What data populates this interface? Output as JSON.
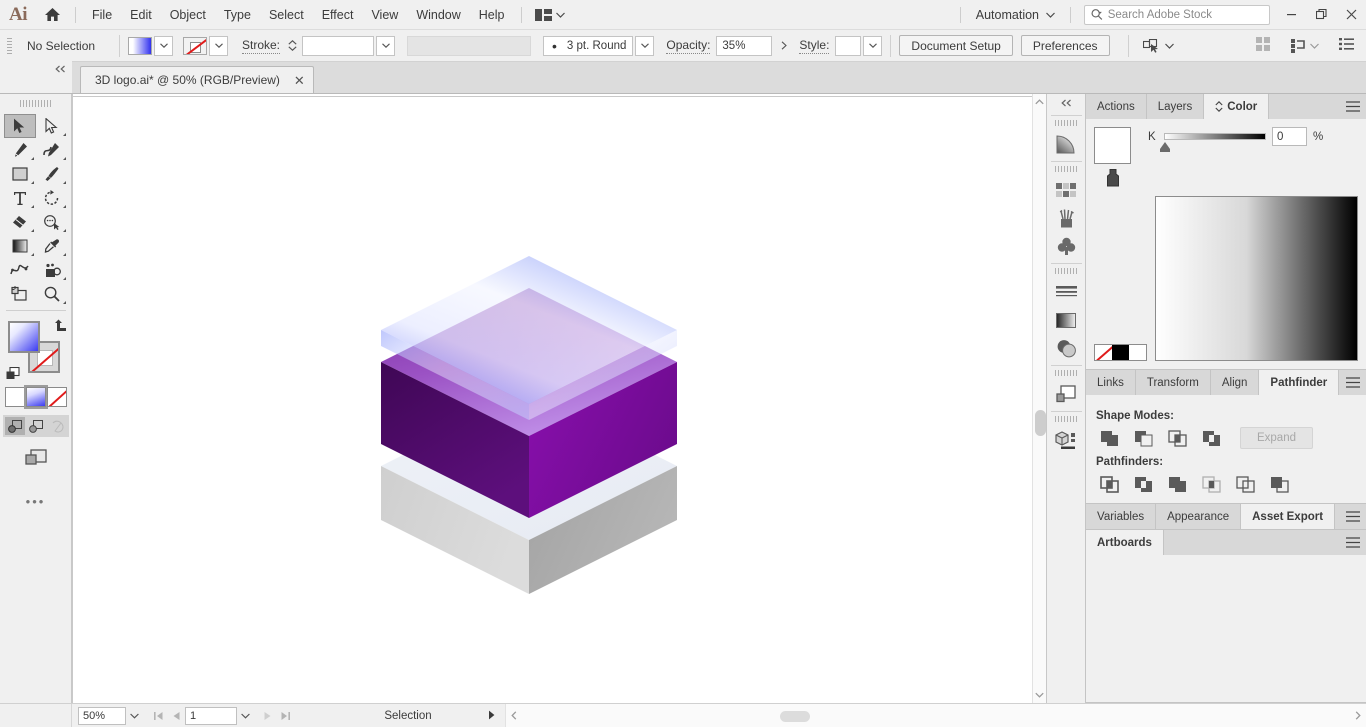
{
  "app": {
    "name": "Adobe Illustrator",
    "logo_text": "Ai"
  },
  "menubar": {
    "home_icon": "home-icon",
    "items": [
      {
        "label": "File"
      },
      {
        "label": "Edit"
      },
      {
        "label": "Object"
      },
      {
        "label": "Type"
      },
      {
        "label": "Select"
      },
      {
        "label": "Effect"
      },
      {
        "label": "View"
      },
      {
        "label": "Window"
      },
      {
        "label": "Help"
      }
    ],
    "arrange_icon": "arrange-documents-icon",
    "workspace": {
      "label": "Automation",
      "chevron": "chevron-down-icon"
    },
    "search": {
      "placeholder": "Search Adobe Stock",
      "value": "",
      "icon": "search-icon"
    },
    "window_controls": {
      "minimize": "minimize-icon",
      "restore": "restore-icon",
      "close": "close-icon"
    }
  },
  "controlbar": {
    "selection_state": "No Selection",
    "fill_swatch": "gradient-fill-swatch",
    "stroke_swatch": "none-stroke-swatch",
    "stroke_label": "Stroke:",
    "stroke_weight": "",
    "stroke_profile": "",
    "brush_label": "3 pt. Round",
    "opacity_label": "Opacity:",
    "opacity_value": "35%",
    "style_label": "Style:",
    "style_value": "",
    "document_setup_label": "Document Setup",
    "preferences_label": "Preferences",
    "select_similar_icon": "select-similar-objects-icon",
    "right_icons": [
      {
        "name": "grid-view-icon"
      },
      {
        "name": "align-options-icon"
      },
      {
        "name": "panel-list-icon"
      }
    ]
  },
  "document": {
    "tab_title": "3D logo.ai* @ 50% (RGB/Preview)",
    "close_icon": "close-icon",
    "collapse_icon": "collapse-panel-icon"
  },
  "toolbar": {
    "grip": "panel-grip",
    "tools": [
      {
        "name": "selection-tool",
        "active": true,
        "has_flyout": false
      },
      {
        "name": "direct-selection-tool",
        "active": false,
        "has_flyout": true
      },
      {
        "name": "pen-tool",
        "active": false,
        "has_flyout": true
      },
      {
        "name": "curvature-tool",
        "active": false,
        "has_flyout": true
      },
      {
        "name": "rectangle-tool",
        "active": false,
        "has_flyout": true
      },
      {
        "name": "paintbrush-tool",
        "active": false,
        "has_flyout": true
      },
      {
        "name": "type-tool",
        "active": false,
        "has_flyout": true
      },
      {
        "name": "rotate-tool",
        "active": false,
        "has_flyout": true
      },
      {
        "name": "eraser-tool",
        "active": false,
        "has_flyout": true
      },
      {
        "name": "shape-builder-tool",
        "active": false,
        "has_flyout": true
      },
      {
        "name": "gradient-tool",
        "active": false,
        "has_flyout": true
      },
      {
        "name": "eyedropper-tool",
        "active": false,
        "has_flyout": true
      },
      {
        "name": "blend-tool",
        "active": false,
        "has_flyout": false
      },
      {
        "name": "symbol-sprayer-tool",
        "active": false,
        "has_flyout": true
      },
      {
        "name": "artboard-tool",
        "active": false,
        "has_flyout": false
      },
      {
        "name": "zoom-tool",
        "active": false,
        "has_flyout": true
      }
    ],
    "fill_stroke": {
      "fill": "gradient-fill",
      "stroke": "none-stroke",
      "swap_icon": "swap-fill-stroke-icon",
      "default_icon": "default-fill-stroke-icon"
    },
    "color_modes": [
      {
        "name": "color-mode-flat",
        "selected": false
      },
      {
        "name": "color-mode-gradient",
        "selected": true
      },
      {
        "name": "color-mode-none",
        "selected": false
      }
    ],
    "screen_modes": [
      {
        "name": "draw-normal-mode",
        "selected": true
      },
      {
        "name": "draw-behind-mode",
        "selected": false
      },
      {
        "name": "draw-inside-mode",
        "selected": false
      }
    ],
    "screen_mode_icon": "change-screen-mode-icon",
    "more_tools": "edit-toolbar-ellipsis"
  },
  "canvas": {
    "background": "#ffffff",
    "artwork_name": "3d-layered-cube-logo",
    "layers": [
      {
        "name": "top-plate-blue-glass",
        "top_fill": "linear-gradient blue to white",
        "opacity": 0.55
      },
      {
        "name": "middle-cube-purple",
        "top_fill": "#8a3fb0 to #c792e8",
        "left_fill": "#4c0d63",
        "right_fill": "#7a0d9c"
      },
      {
        "name": "bottom-plate-gray",
        "top_fill": "#eef1f7",
        "left_fill": "#d6d6d6",
        "right_fill": "#a8a8a8"
      }
    ],
    "vertical_scrollbar": "vertical-scrollbar",
    "horizontal_scrollbar": "horizontal-scrollbar"
  },
  "rail": {
    "collapse_icon": "collapse-icon",
    "groups": [
      {
        "icons": [
          {
            "name": "gradient-panel-icon"
          }
        ]
      },
      {
        "icons": [
          {
            "name": "swatches-panel-icon"
          },
          {
            "name": "brushes-panel-icon"
          },
          {
            "name": "symbols-panel-icon"
          }
        ]
      },
      {
        "icons": [
          {
            "name": "stroke-panel-icon"
          },
          {
            "name": "gradient-fill-icon"
          },
          {
            "name": "transparency-panel-icon"
          }
        ]
      },
      {
        "icons": [
          {
            "name": "layers-panel-icon"
          }
        ]
      },
      {
        "icons": [
          {
            "name": "3d-materials-panel-icon"
          }
        ]
      }
    ]
  },
  "dock": {
    "panels": [
      {
        "id": "color-panel",
        "tabs": [
          {
            "label": "Actions",
            "active": false,
            "icon": null
          },
          {
            "label": "Layers",
            "active": false,
            "icon": null
          },
          {
            "label": "Color",
            "active": true,
            "icon": "expand-collapse-icon"
          }
        ],
        "menu_icon": "panel-menu-icon",
        "color": {
          "current_fill": "#ffffff",
          "stroke_icon": "stroke-indicator-icon",
          "channel_label": "K",
          "channel_value": "0",
          "percent_symbol": "%",
          "ramp": "white-to-black",
          "mini_swatches": [
            {
              "name": "none-swatch"
            },
            {
              "name": "black-swatch"
            },
            {
              "name": "white-swatch"
            }
          ],
          "spectrum": "grayscale-spectrum"
        }
      },
      {
        "id": "pathfinder-panel",
        "tabs": [
          {
            "label": "Links",
            "active": false
          },
          {
            "label": "Transform",
            "active": false
          },
          {
            "label": "Align",
            "active": false
          },
          {
            "label": "Pathfinder",
            "active": true
          }
        ],
        "menu_icon": "panel-menu-icon",
        "pathfinder": {
          "shape_modes_label": "Shape Modes:",
          "shape_modes": [
            {
              "name": "unite-button"
            },
            {
              "name": "minus-front-button"
            },
            {
              "name": "intersect-button"
            },
            {
              "name": "exclude-button"
            }
          ],
          "expand_label": "Expand",
          "expand_enabled": false,
          "pathfinders_label": "Pathfinders:",
          "pathfinders": [
            {
              "name": "divide-button"
            },
            {
              "name": "trim-button"
            },
            {
              "name": "merge-button"
            },
            {
              "name": "crop-button"
            },
            {
              "name": "outline-button"
            },
            {
              "name": "minus-back-button"
            }
          ]
        }
      },
      {
        "id": "asset-export-panel",
        "tabs": [
          {
            "label": "Variables",
            "active": false
          },
          {
            "label": "Appearance",
            "active": false
          },
          {
            "label": "Asset Export",
            "active": true
          }
        ],
        "menu_icon": "panel-menu-icon"
      },
      {
        "id": "artboards-panel",
        "tabs": [
          {
            "label": "Artboards",
            "active": true
          }
        ],
        "menu_icon": "panel-menu-icon"
      }
    ]
  },
  "statusbar": {
    "zoom_value": "50%",
    "zoom_chevron": "chevron-down-icon",
    "first_page_icon": "first-artboard-icon",
    "prev_page_icon": "previous-artboard-icon",
    "page_value": "1",
    "page_chevron": "chevron-down-icon",
    "next_page_icon": "next-artboard-icon",
    "last_page_icon": "last-artboard-icon",
    "status_text": "Selection",
    "status_menu_icon": "status-menu-arrow-icon",
    "scroll_left_icon": "scroll-left-icon",
    "scroll_right_icon": "scroll-right-icon"
  }
}
